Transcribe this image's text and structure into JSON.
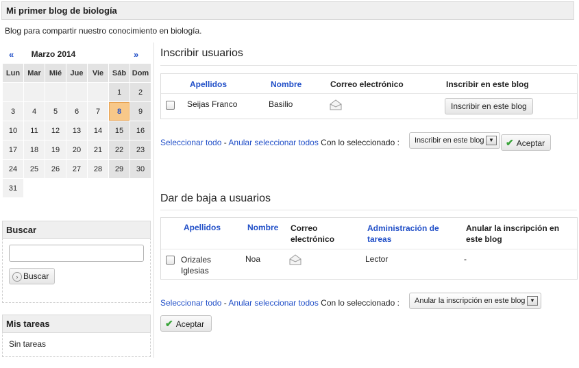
{
  "blog": {
    "title": "Mi primer blog de biología",
    "description": "Blog para compartir nuestro conocimiento en biología."
  },
  "calendar": {
    "prev": "«",
    "next": "»",
    "month_title": "Marzo 2014",
    "weekdays": [
      "Lun",
      "Mar",
      "Mié",
      "Jue",
      "Vie",
      "Sáb",
      "Dom"
    ],
    "weeks": [
      [
        "",
        "",
        "",
        "",
        "",
        "1",
        "2"
      ],
      [
        "3",
        "4",
        "5",
        "6",
        "7",
        "8",
        "9"
      ],
      [
        "10",
        "11",
        "12",
        "13",
        "14",
        "15",
        "16"
      ],
      [
        "17",
        "18",
        "19",
        "20",
        "21",
        "22",
        "23"
      ],
      [
        "24",
        "25",
        "26",
        "27",
        "28",
        "29",
        "30"
      ],
      [
        "31",
        "",
        "",
        "",
        "",
        "",
        ""
      ]
    ],
    "today": "8"
  },
  "search": {
    "title": "Buscar",
    "input_value": "",
    "button_label": "Buscar"
  },
  "tasks": {
    "title": "Mis tareas",
    "empty_text": "Sin tareas"
  },
  "enroll": {
    "heading": "Inscribir usuarios",
    "columns": [
      "Apellidos",
      "Nombre",
      "Correo electrónico",
      "Inscribir en este blog"
    ],
    "rows": [
      {
        "apellidos": "Seijas Franco",
        "nombre": "Basilio",
        "action_label": "Inscribir en este blog"
      }
    ],
    "select_all": "Seleccionar todo",
    "separator": "-",
    "deselect_all": "Anular seleccionar todos",
    "with_selected": "Con lo seleccionado :",
    "select_value": "Inscribir en este blog",
    "accept_label": "Aceptar"
  },
  "unenroll": {
    "heading": "Dar de baja a usuarios",
    "columns": [
      "Apellidos",
      "Nombre",
      "Correo electrónico",
      "Administración de tareas",
      "Anular la inscripción en este blog"
    ],
    "rows": [
      {
        "apellidos": "Orizales Iglesias",
        "nombre": "Noa",
        "role": "Lector",
        "action": "-"
      }
    ],
    "select_all": "Seleccionar todo",
    "separator": "-",
    "deselect_all": "Anular seleccionar todos",
    "with_selected": "Con lo seleccionado :",
    "select_value": "Anular la inscripción en este blog",
    "accept_label": "Aceptar"
  },
  "colors": {
    "link": "#2250c8",
    "today_bg": "#f8c889",
    "accept_check": "#3aa43a"
  }
}
